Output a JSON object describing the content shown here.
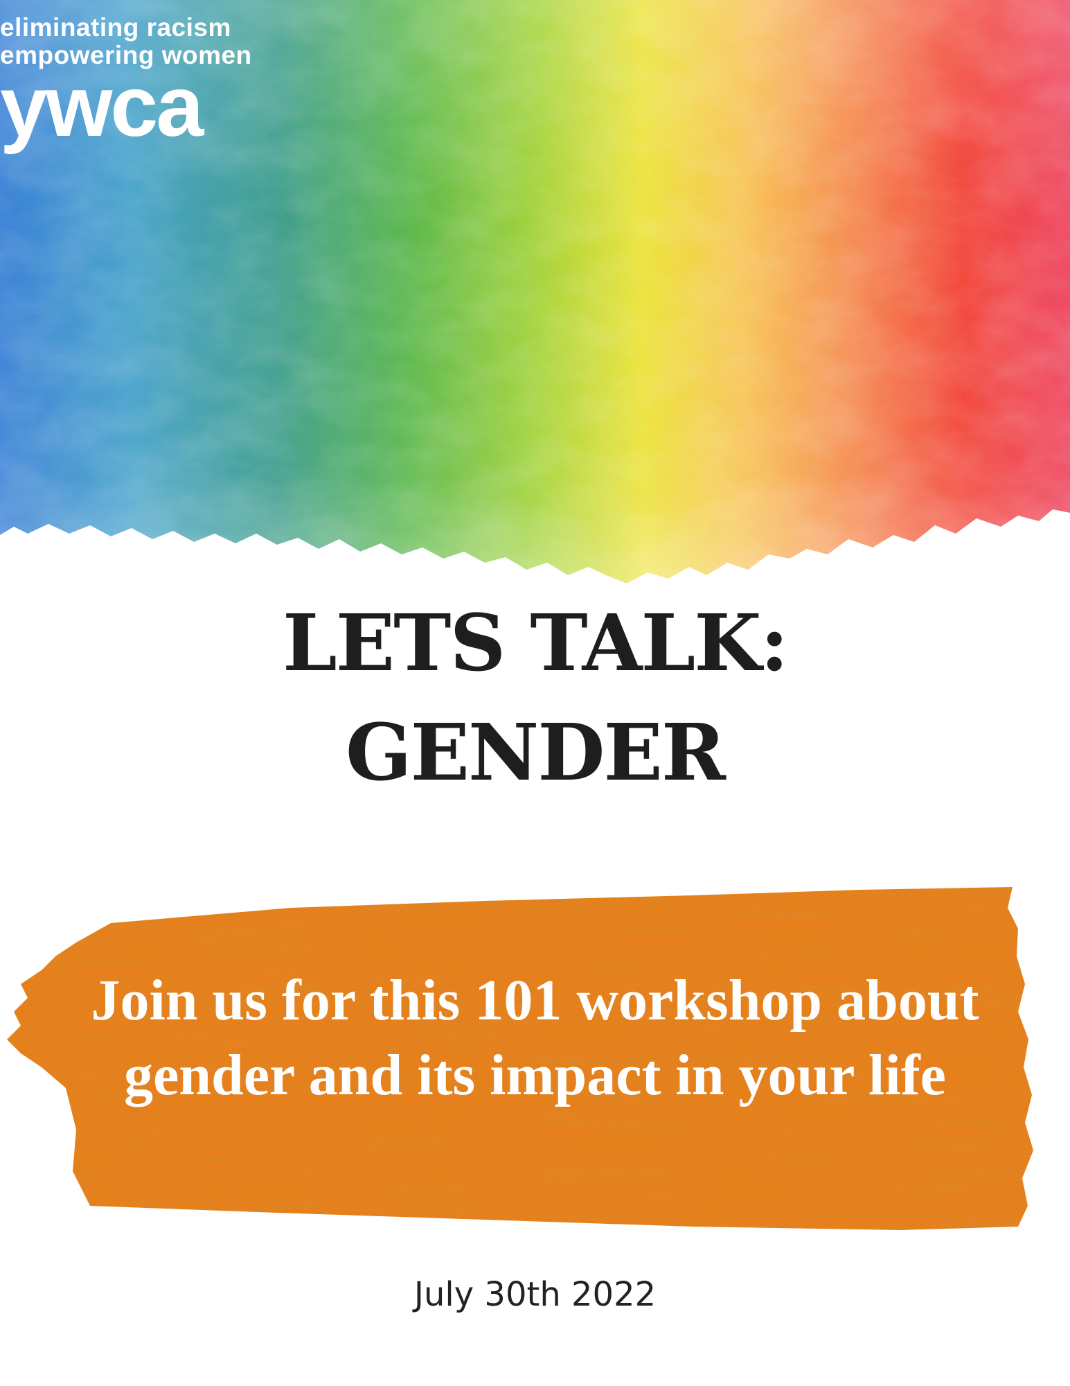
{
  "logo": {
    "tagline_1": "eliminating racism",
    "tagline_2": "empowering women",
    "brand": "ywca"
  },
  "title": {
    "line_1": "LETS TALK:",
    "line_2": "GENDER"
  },
  "subtitle": {
    "line_1": "Join us for this 101 workshop about",
    "line_2": "gender and its impact in your life"
  },
  "date": "July 30th 2022",
  "colors": {
    "brush": "#e6801c",
    "title_text": "#1e1e1e",
    "subtitle_text": "#ffffff",
    "rainbow": [
      "#3a7fd0",
      "#4aa6c4",
      "#58b35a",
      "#8fcf3a",
      "#e8e23a",
      "#f5a34a",
      "#f25a3c",
      "#ec3f4e"
    ]
  }
}
